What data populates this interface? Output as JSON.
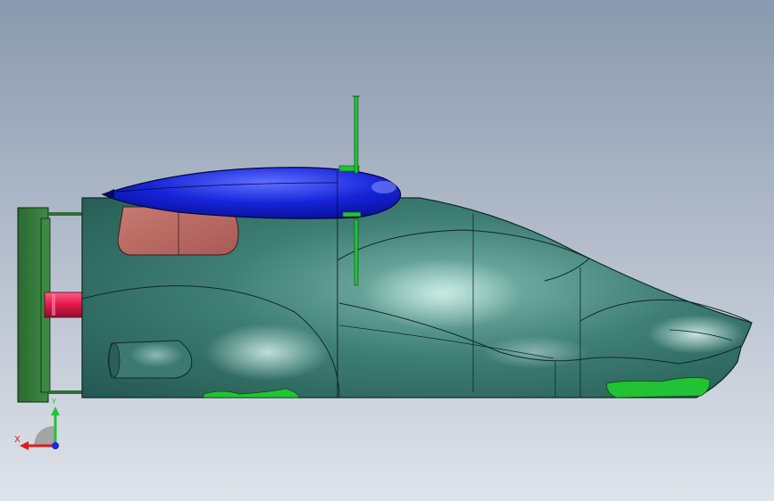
{
  "viewport": {
    "background_top": "#8a99ad",
    "background_bottom": "#dfe3ea",
    "body_color": "#2f6b63",
    "body_highlight": "#bfe7dd",
    "canopy_color": "#0a12c8",
    "window_color": "#b8665e",
    "exhaust_color": "#e0194a",
    "vent_color": "#22c236",
    "wheel_color": "#2e6e33"
  },
  "triad": {
    "x_label": "X",
    "y_label": "Y",
    "x_color": "#e01919",
    "y_color": "#22c236",
    "z_color": "#1a2ad6"
  }
}
